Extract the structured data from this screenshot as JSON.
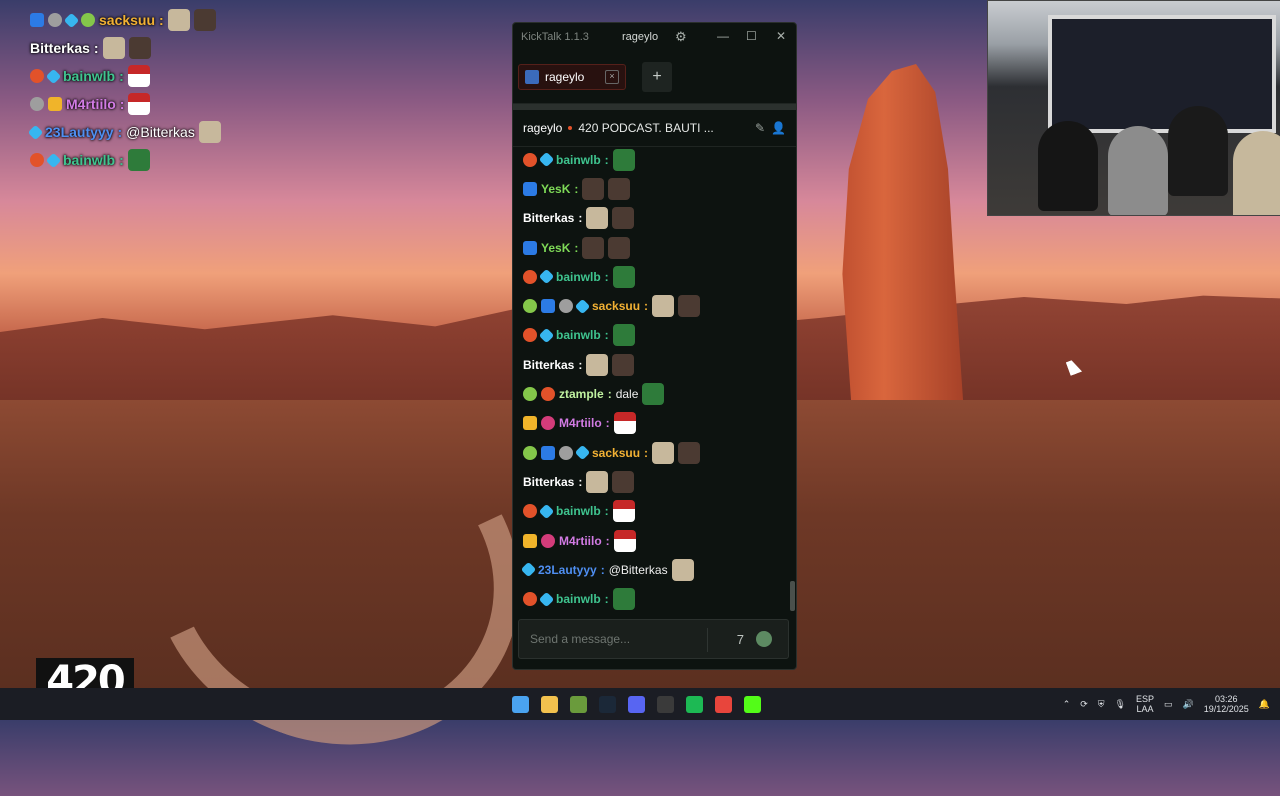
{
  "overlay_chat": [
    {
      "user": "sacksuu",
      "color": "#f2b134",
      "message": "",
      "badges": [
        "b-blue",
        "b-gray",
        "b-cyan",
        "b-green"
      ],
      "emotes": [
        "emote",
        "emote dark"
      ]
    },
    {
      "user": "Bitterkas",
      "color": "#ffffff",
      "message": "",
      "badges": [],
      "emotes": [
        "emote",
        "emote dark"
      ]
    },
    {
      "user": "bainwlb",
      "color": "#3fc48f",
      "message": "",
      "badges": [
        "b-red",
        "b-cyan"
      ],
      "emotes": [
        "emote santa"
      ]
    },
    {
      "user": "M4rtiilo",
      "color": "#d27be4",
      "message": "",
      "badges": [
        "b-gray",
        "b-gold"
      ],
      "emotes": [
        "emote santa"
      ]
    },
    {
      "user": "23Lautyyy",
      "color": "#4f8ff2",
      "message": "@Bitterkas",
      "badges": [
        "b-cyan"
      ],
      "emotes": [
        "emote"
      ]
    },
    {
      "user": "bainwlb",
      "color": "#3fc48f",
      "message": "",
      "badges": [
        "b-red",
        "b-cyan"
      ],
      "emotes": [
        "emote green"
      ]
    }
  ],
  "app": {
    "title": "KickTalk 1.1.3",
    "titlebar_user": "rageylo",
    "minimize": "—",
    "maximize": "☐",
    "close": "✕",
    "tab_label": "rageylo",
    "tab_close": "×",
    "add_tab": "+",
    "channel": "rageylo",
    "stream_title": "420 PODCAST. BAUTI ...",
    "input_placeholder": "Send a message..."
  },
  "messages": [
    {
      "user": "bainwlb",
      "color": "#3fc48f",
      "badges": [
        "b-red",
        "b-cyan"
      ],
      "text": "",
      "emotes": [
        "emote green"
      ]
    },
    {
      "user": "YesK",
      "color": "#7ed957",
      "badges": [
        "b-blue"
      ],
      "text": "",
      "emotes": [
        "emote dark",
        "emote dark"
      ]
    },
    {
      "user": "Bitterkas",
      "color": "#ffffff",
      "badges": [],
      "text": "",
      "emotes": [
        "emote",
        "emote dark"
      ]
    },
    {
      "user": "YesK",
      "color": "#7ed957",
      "badges": [
        "b-blue"
      ],
      "text": "",
      "emotes": [
        "emote dark",
        "emote dark"
      ]
    },
    {
      "user": "bainwlb",
      "color": "#3fc48f",
      "badges": [
        "b-red",
        "b-cyan"
      ],
      "text": "",
      "emotes": [
        "emote green"
      ]
    },
    {
      "user": "sacksuu",
      "color": "#f2b134",
      "badges": [
        "b-green",
        "b-blue",
        "b-gray",
        "b-cyan"
      ],
      "text": "",
      "emotes": [
        "emote",
        "emote dark"
      ]
    },
    {
      "user": "bainwlb",
      "color": "#3fc48f",
      "badges": [
        "b-red",
        "b-cyan"
      ],
      "text": "",
      "emotes": [
        "emote green"
      ]
    },
    {
      "user": "Bitterkas",
      "color": "#ffffff",
      "badges": [],
      "text": "",
      "emotes": [
        "emote",
        "emote dark"
      ]
    },
    {
      "user": "ztample",
      "color": "#c0f2a0",
      "badges": [
        "b-green",
        "b-red"
      ],
      "text": "dale",
      "emotes": [
        "emote green"
      ]
    },
    {
      "user": "M4rtiilo",
      "color": "#d27be4",
      "badges": [
        "b-gold",
        "b-pink"
      ],
      "text": "",
      "emotes": [
        "emote santa"
      ]
    },
    {
      "user": "sacksuu",
      "color": "#f2b134",
      "badges": [
        "b-green",
        "b-blue",
        "b-gray",
        "b-cyan"
      ],
      "text": "",
      "emotes": [
        "emote",
        "emote dark"
      ]
    },
    {
      "user": "Bitterkas",
      "color": "#ffffff",
      "badges": [],
      "text": "",
      "emotes": [
        "emote",
        "emote dark"
      ]
    },
    {
      "user": "bainwlb",
      "color": "#3fc48f",
      "badges": [
        "b-red",
        "b-cyan"
      ],
      "text": "",
      "emotes": [
        "emote santa"
      ]
    },
    {
      "user": "M4rtiilo",
      "color": "#d27be4",
      "badges": [
        "b-gold",
        "b-pink"
      ],
      "text": "",
      "emotes": [
        "emote santa"
      ]
    },
    {
      "user": "23Lautyyy",
      "color": "#4f8ff2",
      "badges": [
        "b-cyan"
      ],
      "text": "@Bitterkas",
      "emotes": [
        "emote"
      ]
    },
    {
      "user": "bainwlb",
      "color": "#3fc48f",
      "badges": [
        "b-red",
        "b-cyan"
      ],
      "text": "",
      "emotes": [
        "emote green"
      ]
    }
  ],
  "logo_text": "420",
  "taskbar": {
    "icons": [
      {
        "name": "windows-start-icon",
        "color": "#4aa3f0"
      },
      {
        "name": "file-explorer-icon",
        "color": "#f2c14e"
      },
      {
        "name": "minecraft-icon",
        "color": "#6a9b3c"
      },
      {
        "name": "steam-icon",
        "color": "#1b2838"
      },
      {
        "name": "discord-icon",
        "color": "#5865f2"
      },
      {
        "name": "obs-icon",
        "color": "#3a3a3a"
      },
      {
        "name": "spotify-icon",
        "color": "#1db954"
      },
      {
        "name": "chrome-icon",
        "color": "#e8453c"
      },
      {
        "name": "kicktalk-icon",
        "color": "#53fc18"
      }
    ],
    "lang_top": "ESP",
    "lang_bottom": "LAA",
    "time": "03:26",
    "date": "19/12/2025"
  }
}
